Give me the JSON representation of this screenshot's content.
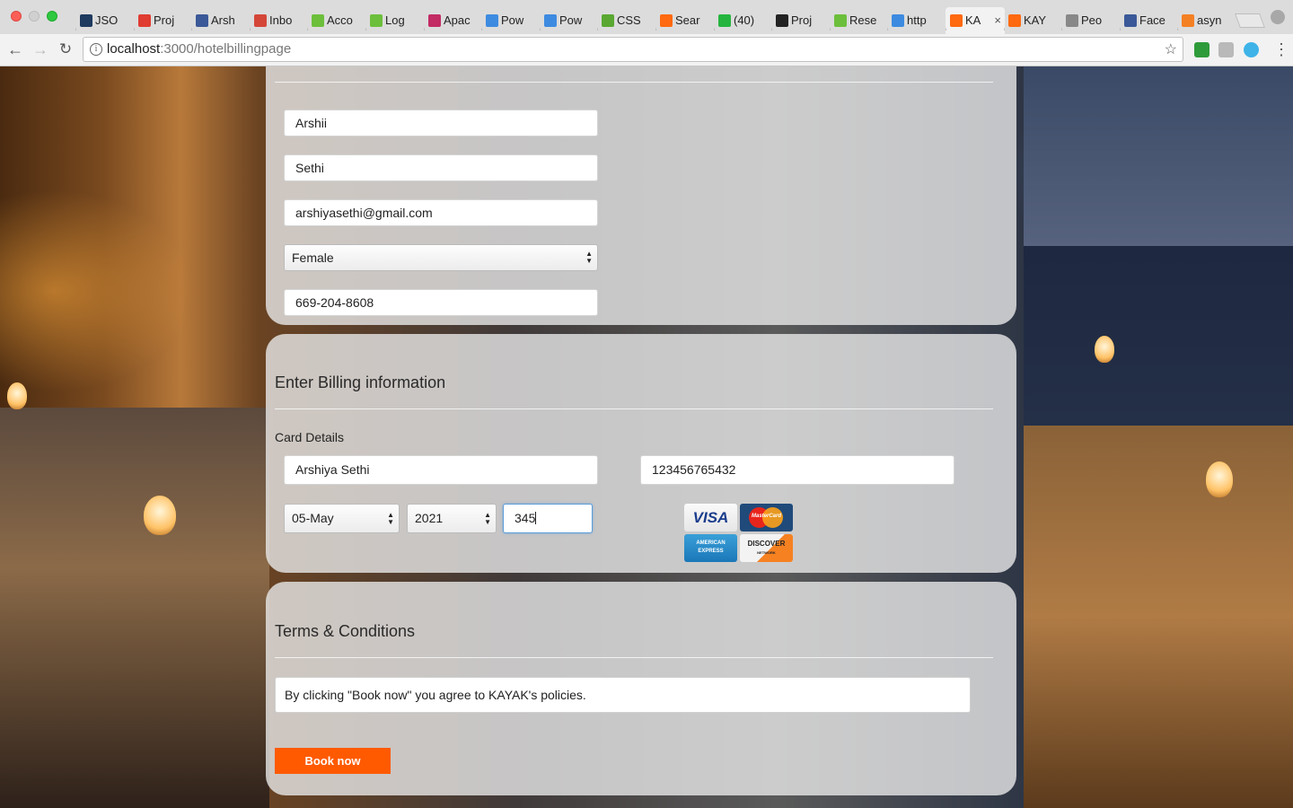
{
  "browser": {
    "tabs": [
      {
        "label": "JSO",
        "icon": "json-icon",
        "color": "#1e3a5f"
      },
      {
        "label": "Proj",
        "icon": "project-ring-icon",
        "color": "#e03c31"
      },
      {
        "label": "Arsh",
        "icon": "facebook-icon",
        "color": "#3b5998"
      },
      {
        "label": "Inbo",
        "icon": "gmail-icon",
        "color": "#d44638"
      },
      {
        "label": "Acco",
        "icon": "recycle-icon",
        "color": "#6cbf3b"
      },
      {
        "label": "Log",
        "icon": "recycle-icon",
        "color": "#6cbf3b"
      },
      {
        "label": "Apac",
        "icon": "apache-feather-icon",
        "color": "#c22b63"
      },
      {
        "label": "Pow",
        "icon": "powtoon-icon",
        "color": "#3d8be0"
      },
      {
        "label": "Pow",
        "icon": "powtoon-icon",
        "color": "#3d8be0"
      },
      {
        "label": "CSS",
        "icon": "css-icon",
        "color": "#5aa832"
      },
      {
        "label": "Sear",
        "icon": "kayak-icon",
        "color": "#ff690f"
      },
      {
        "label": "(40)",
        "icon": "whatsapp-icon",
        "color": "#25b53f"
      },
      {
        "label": "Proj",
        "icon": "github-icon",
        "color": "#222222"
      },
      {
        "label": "Rese",
        "icon": "recycle-icon",
        "color": "#6cbf3b"
      },
      {
        "label": "http",
        "icon": "powtoon-icon",
        "color": "#3d8be0"
      },
      {
        "label": "KA",
        "icon": "kayak-icon",
        "color": "#ff690f",
        "active": true
      },
      {
        "label": "KAY",
        "icon": "kayak-icon",
        "color": "#ff690f"
      },
      {
        "label": "Peo",
        "icon": "document-icon",
        "color": "#888888"
      },
      {
        "label": "Face",
        "icon": "facebook-icon",
        "color": "#3b5998"
      },
      {
        "label": "asyn",
        "icon": "stack-icon",
        "color": "#f48024"
      }
    ],
    "url_host": "localhost",
    "url_path": ":3000/hotelbillingpage"
  },
  "traveler": {
    "first_name": "Arshii",
    "last_name": "Sethi",
    "email": "arshiyasethi@gmail.com",
    "gender": "Female",
    "phone": "669-204-8608"
  },
  "billing": {
    "heading": "Enter Billing information",
    "card_details_label": "Card Details",
    "card_name": "Arshiya Sethi",
    "card_number": "123456765432",
    "expiry_month": "05-May",
    "expiry_year": "2021",
    "cvv": "345",
    "card_logos": {
      "visa": "VISA",
      "mastercard": "MasterCard",
      "amex": "AMERICAN EXPRESS",
      "discover": "DISCOVER",
      "discover_sub": "NETWORK"
    }
  },
  "terms": {
    "heading": "Terms & Conditions",
    "text": "By clicking \"Book now\" you agree to KAYAK's policies.",
    "book_label": "Book now"
  },
  "colors": {
    "book_button": "#ff5a00",
    "focus_ring": "#5b9dd9"
  }
}
